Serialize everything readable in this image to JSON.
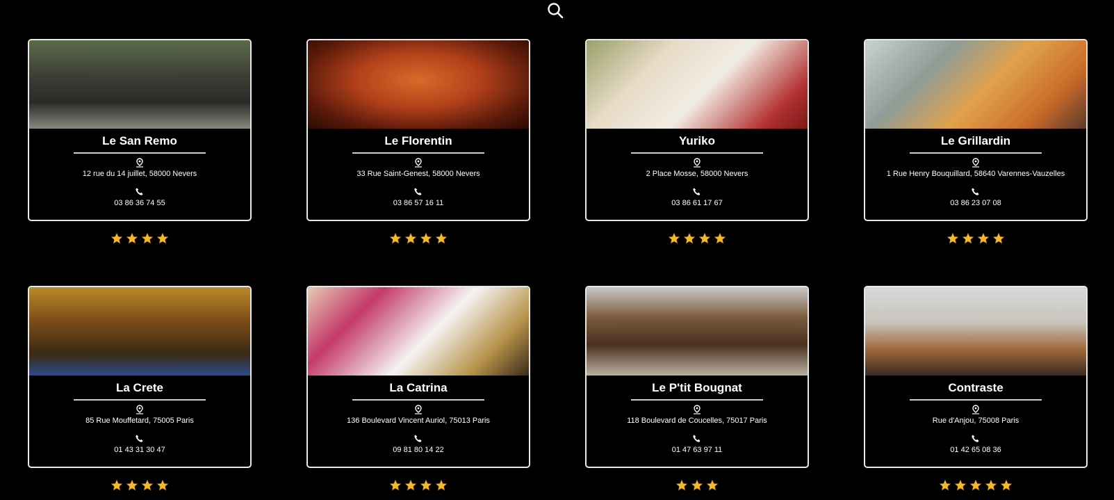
{
  "header": {
    "search_icon": "search-icon"
  },
  "restaurants": [
    {
      "name": "Le San Remo",
      "address": "12 rue du 14 juillet, 58000 Nevers",
      "phone": "03 86 36 74 55",
      "rating": 4,
      "photo": "terrace"
    },
    {
      "name": "Le Florentin",
      "address": "33 Rue Saint-Genest, 58000 Nevers",
      "phone": "03 86 57 16 11",
      "rating": 4,
      "photo": "pizza"
    },
    {
      "name": "Yuriko",
      "address": "2 Place Mosse, 58000 Nevers",
      "phone": "03 86 61 17 67",
      "rating": 4,
      "photo": "yakitori"
    },
    {
      "name": "Le Grillardin",
      "address": "1 Rue Henry Bouquillard, 58640 Varennes-Vauzelles",
      "phone": "03 86 23 07 08",
      "rating": 4,
      "photo": "buffet"
    },
    {
      "name": "La Crete",
      "address": "85 Rue Mouffetard, 75005 Paris",
      "phone": "01 43 31 30 47",
      "rating": 4,
      "photo": "crete"
    },
    {
      "name": "La Catrina",
      "address": "136 Boulevard Vincent Auriol, 75013 Paris",
      "phone": "09 81 80 14 22",
      "rating": 4,
      "photo": "catrina"
    },
    {
      "name": "Le P'tit Bougnat",
      "address": "118 Boulevard de Coucelles, 75017 Paris",
      "phone": "01 47 63 97 11",
      "rating": 3,
      "photo": "bougnat"
    },
    {
      "name": "Contraste",
      "address": "Rue d'Anjou, 75008 Paris",
      "phone": "01 42 65 08 36",
      "rating": 5,
      "photo": "contraste"
    }
  ],
  "colors": {
    "background": "#000000",
    "card_border": "#e9e9e9",
    "star": "#f5b82e"
  }
}
